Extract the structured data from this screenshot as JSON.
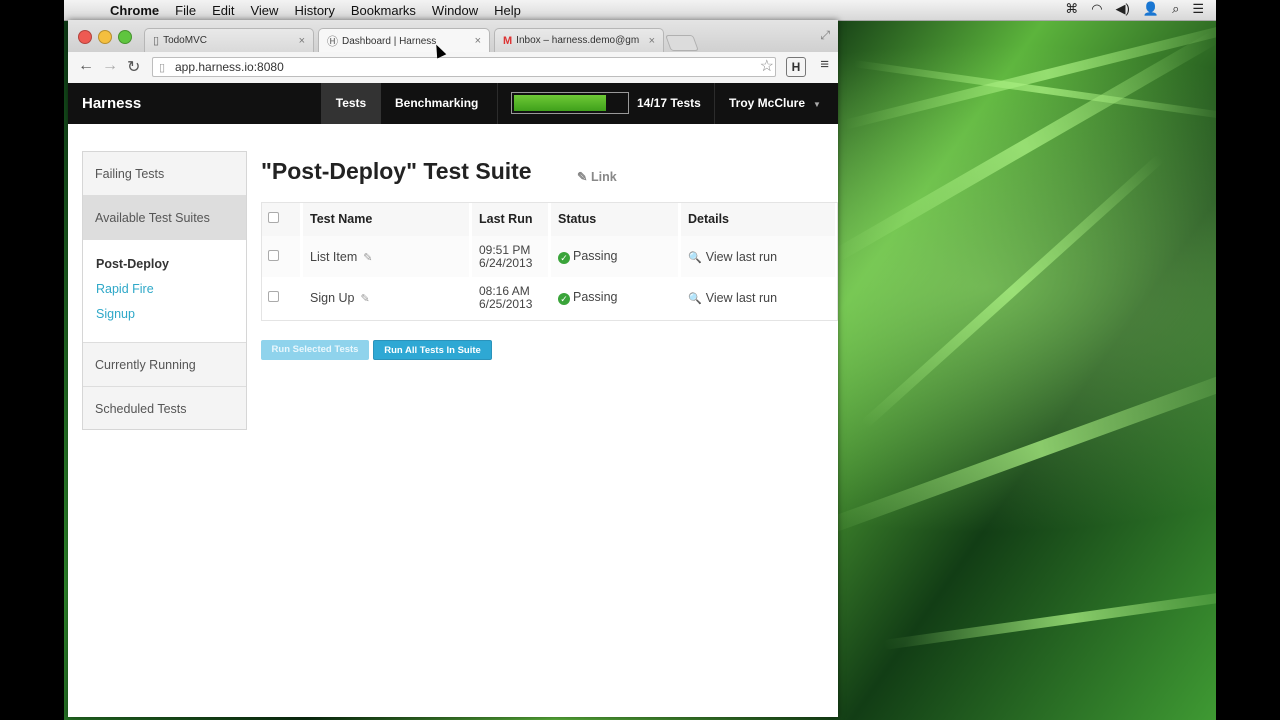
{
  "os_menubar": {
    "app_name": "Chrome",
    "items": [
      "File",
      "Edit",
      "View",
      "History",
      "Bookmarks",
      "Window",
      "Help"
    ]
  },
  "browser": {
    "tabs": [
      {
        "label": "TodoMVC",
        "active": false
      },
      {
        "label": "Dashboard | Harness",
        "active": true
      },
      {
        "label": "Inbox – harness.demo@gm",
        "active": false
      }
    ],
    "url": "app.harness.io:8080",
    "extension_label": "H"
  },
  "app_nav": {
    "brand": "Harness",
    "tests_label": "Tests",
    "benchmarking_label": "Benchmarking",
    "progress_fraction": 0.8235,
    "progress_text": "14/17 Tests",
    "user_name": "Troy McClure"
  },
  "sidebar": {
    "items": [
      "Failing Tests",
      "Available Test Suites",
      "Currently Running",
      "Scheduled Tests"
    ],
    "suites": [
      "Post-Deploy",
      "Rapid Fire",
      "Signup"
    ]
  },
  "main": {
    "title": "\"Post-Deploy\" Test Suite",
    "link_label": "Link",
    "columns": [
      "Test Name",
      "Last Run",
      "Status",
      "Details"
    ],
    "rows": [
      {
        "name": "List Item",
        "time": "09:51 PM",
        "date": "6/24/2013",
        "status": "Passing",
        "details": "View last run"
      },
      {
        "name": "Sign Up",
        "time": "08:16 AM",
        "date": "6/25/2013",
        "status": "Passing",
        "details": "View last run"
      }
    ],
    "run_selected_label": "Run Selected Tests",
    "run_all_label": "Run All Tests In Suite"
  },
  "colors": {
    "nav_bg": "#111111",
    "progress_green": "#4cb227",
    "accent_blue": "#2ea8d4",
    "passing_green": "#3aa43a"
  }
}
